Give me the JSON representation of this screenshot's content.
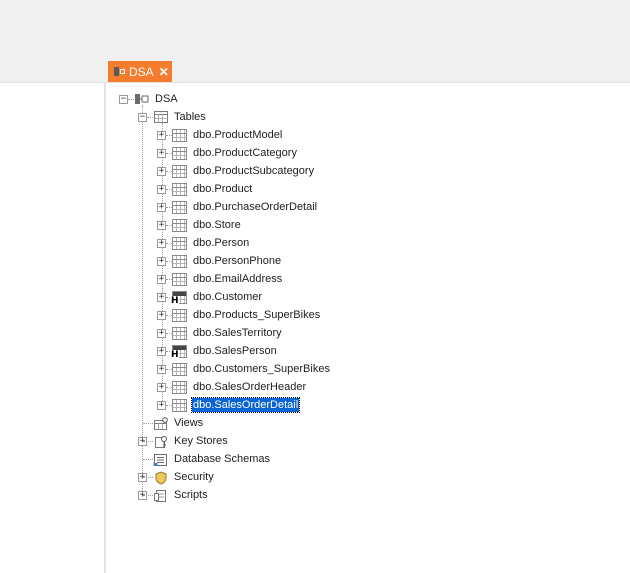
{
  "tab": {
    "label": "DSA",
    "close_glyph": "✕"
  },
  "tree": {
    "root": {
      "label": "DSA",
      "expander": "−"
    },
    "tables_folder": {
      "label": "Tables",
      "expander": "−"
    },
    "tables": [
      {
        "label": "dbo.ProductModel",
        "icon": "table-icon"
      },
      {
        "label": "dbo.ProductCategory",
        "icon": "table-icon"
      },
      {
        "label": "dbo.ProductSubcategory",
        "icon": "table-icon"
      },
      {
        "label": "dbo.Product",
        "icon": "table-icon"
      },
      {
        "label": "dbo.PurchaseOrderDetail",
        "icon": "table-icon"
      },
      {
        "label": "dbo.Store",
        "icon": "table-icon"
      },
      {
        "label": "dbo.Person",
        "icon": "table-icon"
      },
      {
        "label": "dbo.PersonPhone",
        "icon": "table-icon"
      },
      {
        "label": "dbo.EmailAddress",
        "icon": "table-icon"
      },
      {
        "label": "dbo.Customer",
        "icon": "hub-table-icon"
      },
      {
        "label": "dbo.Products_SuperBikes",
        "icon": "table-icon"
      },
      {
        "label": "dbo.SalesTerritory",
        "icon": "table-icon"
      },
      {
        "label": "dbo.SalesPerson",
        "icon": "hub-table-icon"
      },
      {
        "label": "dbo.Customers_SuperBikes",
        "icon": "table-icon"
      },
      {
        "label": "dbo.SalesOrderHeader",
        "icon": "table-icon"
      },
      {
        "label": "dbo.SalesOrderDetail",
        "icon": "table-icon",
        "selected": true
      }
    ],
    "expander_collapsed": "+",
    "siblings": [
      {
        "label": "Views",
        "icon": "views-icon",
        "expander": ""
      },
      {
        "label": "Key Stores",
        "icon": "key-stores-icon",
        "expander": "+"
      },
      {
        "label": "Database Schemas",
        "icon": "schema-icon",
        "expander": ""
      },
      {
        "label": "Security",
        "icon": "shield-icon",
        "expander": "+"
      },
      {
        "label": "Scripts",
        "icon": "scripts-icon",
        "expander": "+"
      }
    ]
  },
  "colors": {
    "tab": "#f47c2c",
    "selection": "#0a64d2"
  }
}
